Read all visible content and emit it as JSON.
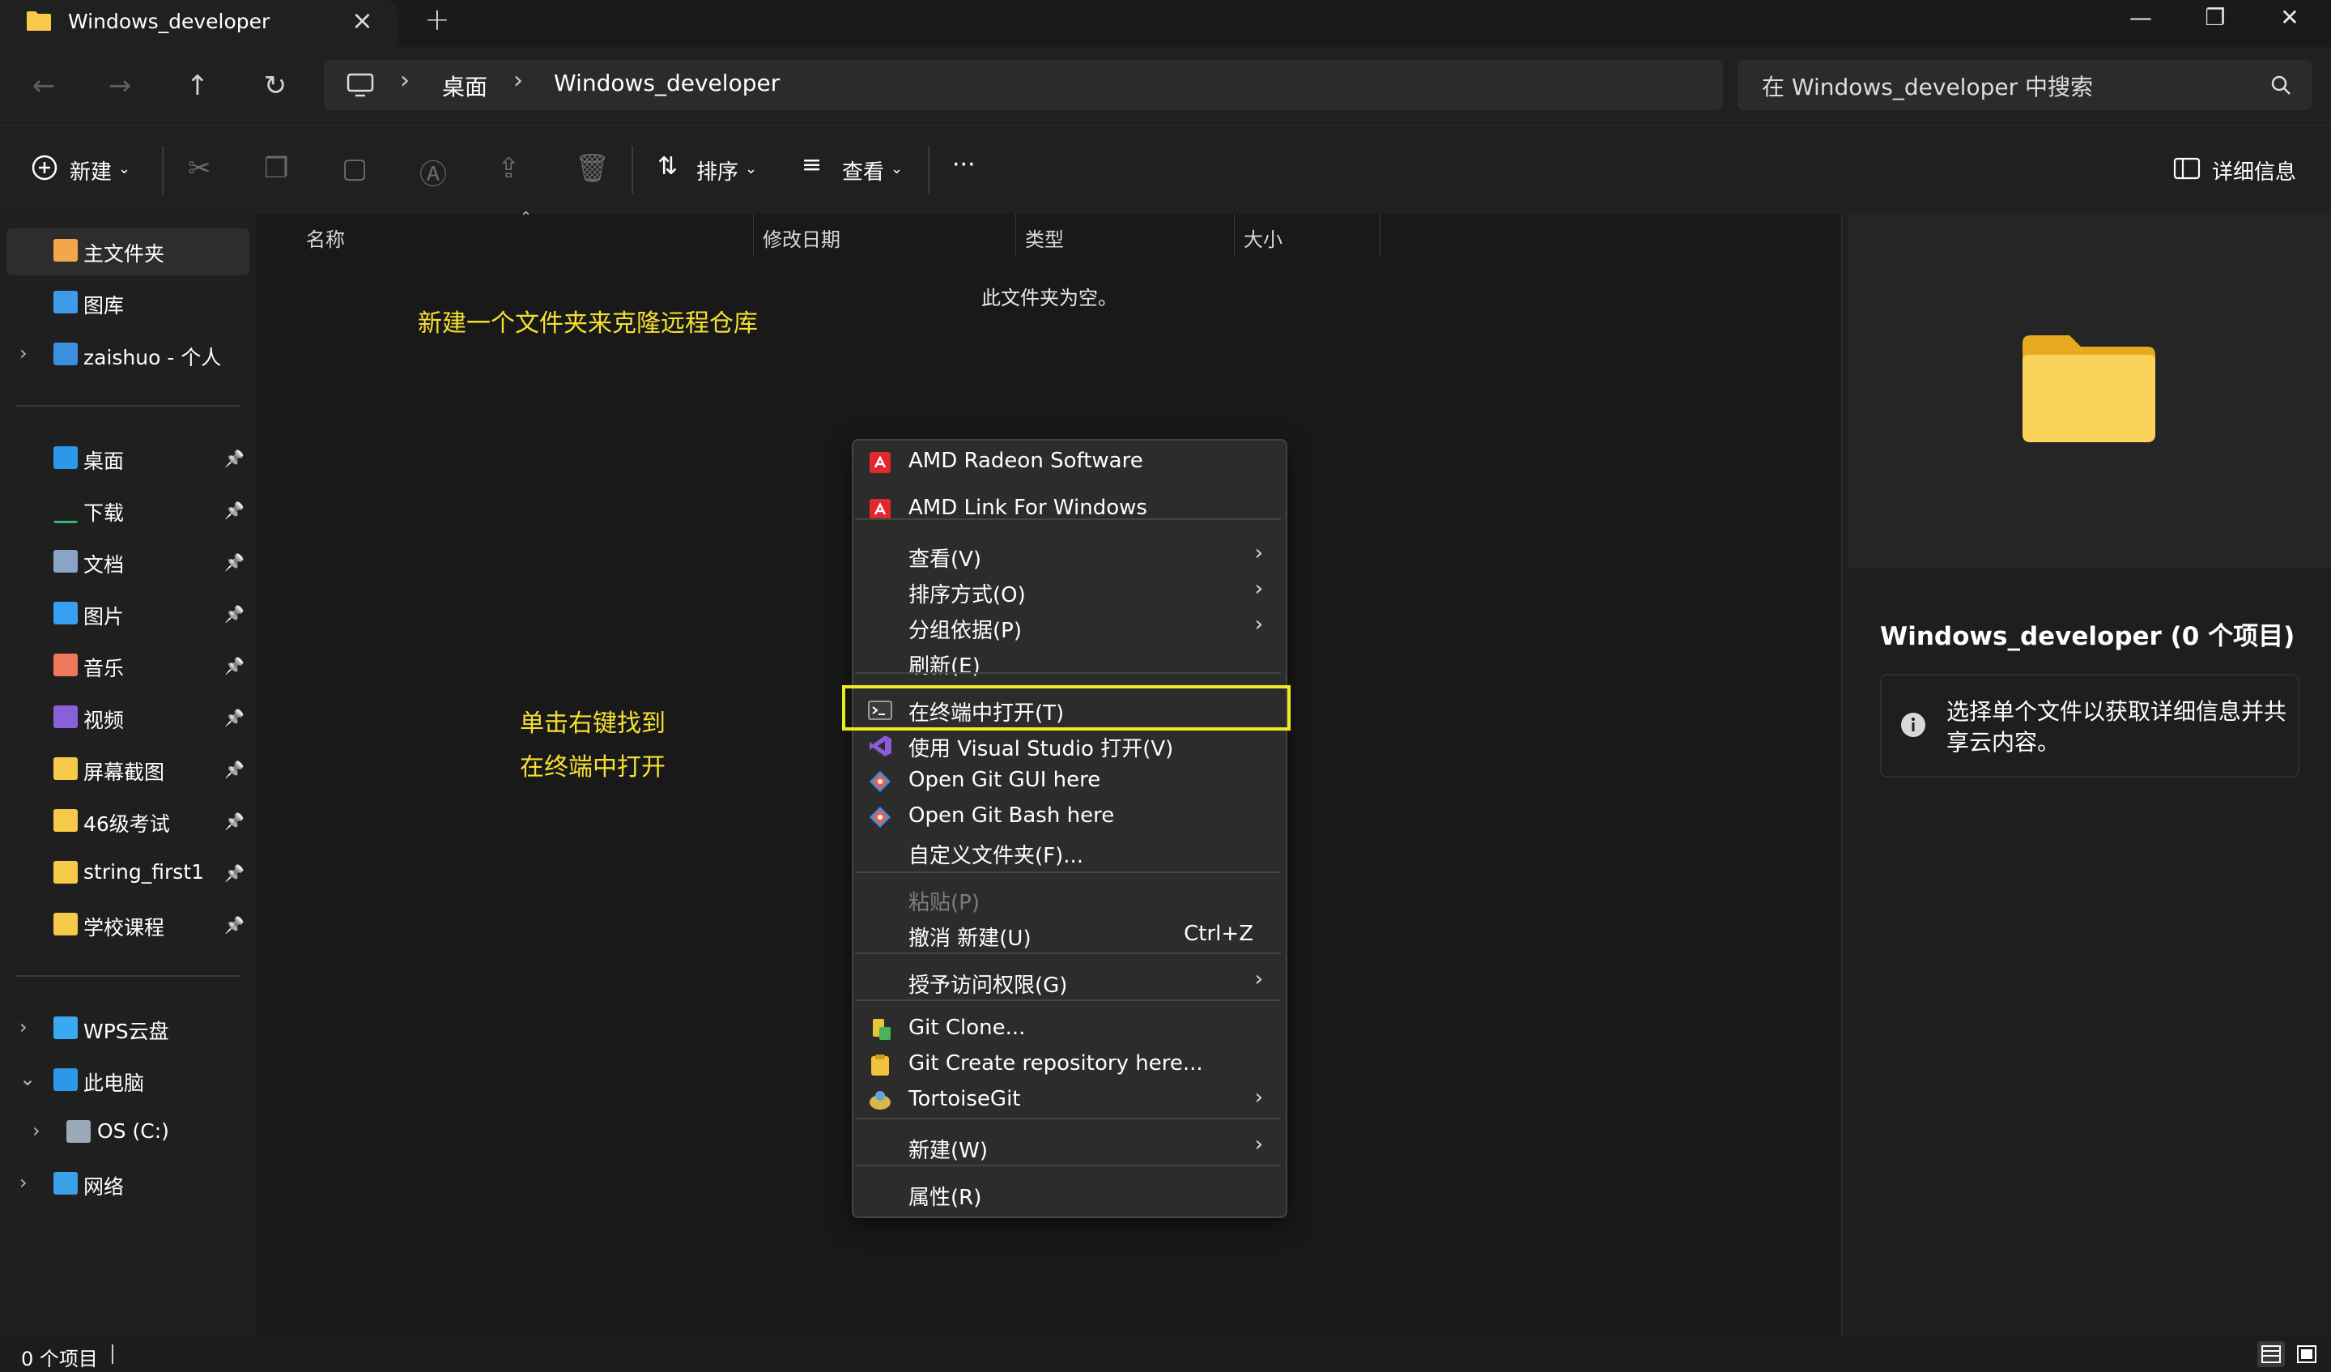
{
  "window": {
    "tab_title": "Windows_developer",
    "controls": {
      "minimize": "—",
      "maximize": "❐",
      "close": "✕"
    }
  },
  "nav": {
    "back": "←",
    "forward": "→",
    "up": "↑",
    "refresh": "↻",
    "breadcrumb": [
      "桌面",
      "Windows_developer"
    ],
    "search_placeholder": "在 Windows_developer 中搜索"
  },
  "toolbar": {
    "new_label": "新建",
    "sort_label": "排序",
    "view_label": "查看",
    "more": "···",
    "details_label": "详细信息"
  },
  "sidebar": {
    "top": [
      {
        "label": "主文件夹",
        "icon": "home-icon",
        "selected": true
      },
      {
        "label": "图库",
        "icon": "gallery-icon"
      },
      {
        "label": "zaishuo - 个人",
        "icon": "onedrive-icon"
      }
    ],
    "pinned": [
      {
        "label": "桌面",
        "icon": "desktop-icon"
      },
      {
        "label": "下载",
        "icon": "download-icon"
      },
      {
        "label": "文档",
        "icon": "documents-icon"
      },
      {
        "label": "图片",
        "icon": "pictures-icon"
      },
      {
        "label": "音乐",
        "icon": "music-icon"
      },
      {
        "label": "视频",
        "icon": "videos-icon"
      },
      {
        "label": "屏幕截图",
        "icon": "folder-icon"
      },
      {
        "label": "46级考试",
        "icon": "folder-icon"
      },
      {
        "label": "string_first1",
        "icon": "folder-icon"
      },
      {
        "label": "学校课程",
        "icon": "folder-icon"
      }
    ],
    "bottom": [
      {
        "label": "WPS云盘",
        "icon": "cloud-icon"
      },
      {
        "label": "此电脑",
        "icon": "computer-icon"
      },
      {
        "label": "OS (C:)",
        "icon": "drive-icon"
      },
      {
        "label": "网络",
        "icon": "network-icon"
      }
    ]
  },
  "main": {
    "columns": [
      "名称",
      "修改日期",
      "类型",
      "大小"
    ],
    "empty_message": "此文件夹为空。",
    "annotation_top": "新建一个文件夹来克隆远程仓库",
    "annotation_mid_1": "单击右键找到",
    "annotation_mid_2": "在终端中打开"
  },
  "context_menu": {
    "items": [
      {
        "label": "AMD Radeon Software",
        "icon": "amd-icon"
      },
      {
        "label": "AMD Link For Windows",
        "icon": "amd-icon"
      },
      {
        "label": "查看(V)",
        "submenu": true
      },
      {
        "label": "排序方式(O)",
        "submenu": true
      },
      {
        "label": "分组依据(P)",
        "submenu": true
      },
      {
        "label": "刷新(E)"
      },
      {
        "label": "在终端中打开(T)",
        "icon": "terminal-icon",
        "highlighted": true
      },
      {
        "label": "使用 Visual Studio 打开(V)",
        "icon": "visual-studio-icon"
      },
      {
        "label": "Open Git GUI here",
        "icon": "git-icon"
      },
      {
        "label": "Open Git Bash here",
        "icon": "git-icon"
      },
      {
        "label": "自定义文件夹(F)..."
      },
      {
        "label": "粘贴(P)",
        "disabled": true
      },
      {
        "label": "撤消 新建(U)",
        "shortcut": "Ctrl+Z"
      },
      {
        "label": "授予访问权限(G)",
        "submenu": true
      },
      {
        "label": "Git Clone...",
        "icon": "git-clone-icon"
      },
      {
        "label": "Git Create repository here...",
        "icon": "git-create-repo-icon"
      },
      {
        "label": "TortoiseGit",
        "icon": "tortoisegit-icon",
        "submenu": true
      },
      {
        "label": "新建(W)",
        "submenu": true
      },
      {
        "label": "属性(R)"
      }
    ]
  },
  "details": {
    "title": "Windows_developer (0 个项目)",
    "info": "选择单个文件以获取详细信息并共享云内容。"
  },
  "status": {
    "count": "0 个项目"
  },
  "colors": {
    "accent_highlight": "#f0ea20",
    "annotation": "#f5e030",
    "folder": "#f7c948"
  }
}
